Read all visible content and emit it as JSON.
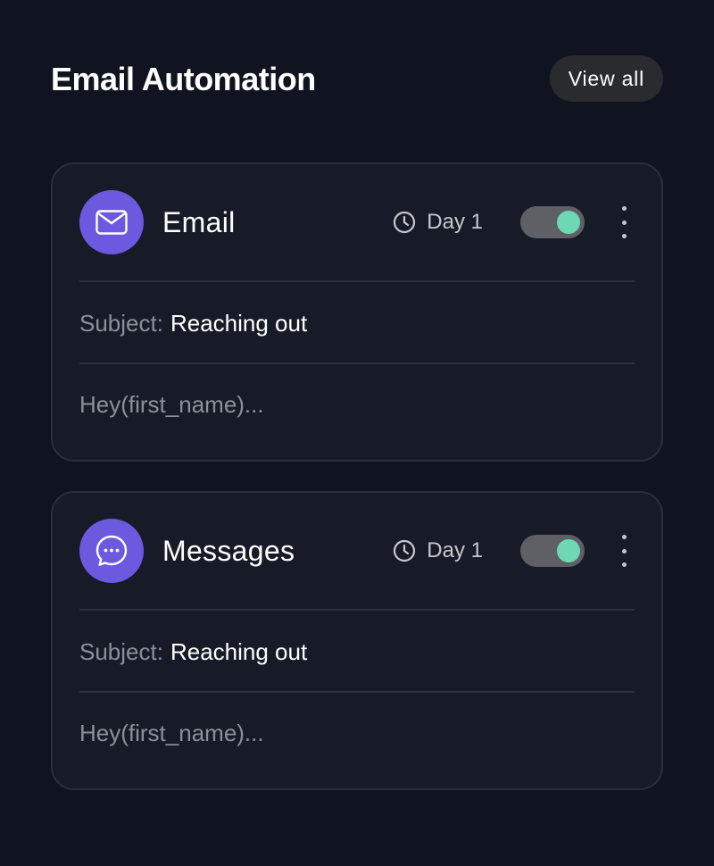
{
  "header": {
    "title": "Email Automation",
    "view_all_label": "View all"
  },
  "colors": {
    "background": "#0f1420",
    "card": "#161b27",
    "accent": "#6b59e0",
    "toggle_on": "#6ed8b4"
  },
  "cards": [
    {
      "icon": "mail-icon",
      "title": "Email",
      "schedule": "Day 1",
      "enabled": true,
      "subject_label": "Subject:",
      "subject_value": "Reaching out",
      "preview": "Hey(first_name)..."
    },
    {
      "icon": "chat-bubble-icon",
      "title": "Messages",
      "schedule": "Day 1",
      "enabled": true,
      "subject_label": "Subject:",
      "subject_value": "Reaching out",
      "preview": "Hey(first_name)..."
    }
  ]
}
